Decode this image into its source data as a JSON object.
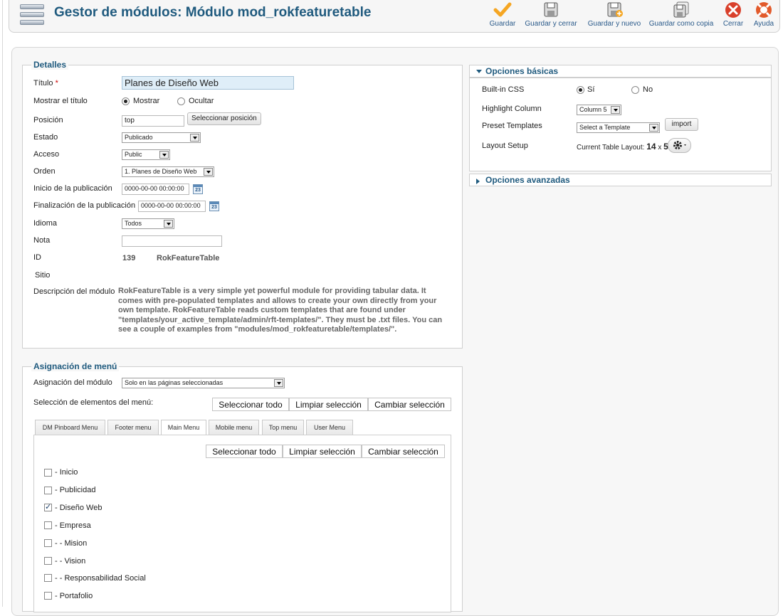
{
  "header": {
    "title": "Gestor de módulos: Módulo mod_rokfeaturetable",
    "toolbar": [
      {
        "label": "Guardar",
        "icon": "checkmark-icon"
      },
      {
        "label": "Guardar y cerrar",
        "icon": "save-icon"
      },
      {
        "label": "Guardar y nuevo",
        "icon": "save-new-icon"
      },
      {
        "label": "Guardar como copia",
        "icon": "save-copy-icon"
      },
      {
        "label": "Cerrar",
        "icon": "close-icon"
      },
      {
        "label": "Ayuda",
        "icon": "help-icon"
      }
    ]
  },
  "details": {
    "legend": "Detalles",
    "title_label": "Título",
    "title_required": "*",
    "title_value": "Planes de Diseño Web",
    "show_title_label": "Mostrar el título",
    "show_option": "Mostrar",
    "hide_option": "Ocultar",
    "position_label": "Posición",
    "position_value": "top",
    "select_position_button": "Seleccionar posición",
    "state_label": "Estado",
    "state_value": "Publicado",
    "access_label": "Acceso",
    "access_value": "Public",
    "order_label": "Orden",
    "order_value": "1. Planes de Diseño Web",
    "publish_start_label": "Inicio de la publicación",
    "publish_start_value": "0000-00-00 00:00:00",
    "publish_end_label": "Finalización de la publicación",
    "publish_end_value": "0000-00-00 00:00:00",
    "calendar_glyph": "23",
    "language_label": "Idioma",
    "language_value": "Todos",
    "note_label": "Nota",
    "note_value": "",
    "id_label": "ID",
    "id_value": "139",
    "module_name": "RokFeatureTable",
    "site_label": "Sitio",
    "description_label": "Descripción del módulo",
    "description_text": "RokFeatureTable is a very simple yet powerful module for providing tabular data. It comes with pre-populated templates and allows to create your own directly from your own template. RokFeatureTable reads custom templates that are found under \"templates/your_active_template/admin/rft-templates/\". They must be .txt files. You can see a couple of examples from \"modules/mod_rokfeaturetable/templates/\"."
  },
  "menu_assignment": {
    "legend": "Asignación de menú",
    "assignment_label": "Asignación del módulo",
    "assignment_value": "Solo en las páginas seleccionadas",
    "selection_label": "Selección de elementos del menú:",
    "select_all": "Seleccionar todo",
    "clear_selection": "Limpiar selección",
    "toggle_selection": "Cambiar selección",
    "tabs": [
      "DM Pinboard Menu",
      "Footer menu",
      "Main Menu",
      "Mobile menu",
      "Top menu",
      "User Menu"
    ],
    "active_tab": "Main Menu",
    "items": [
      {
        "label": "- Inicio",
        "checked": false
      },
      {
        "label": "- Publicidad",
        "checked": false
      },
      {
        "label": "- Diseño Web",
        "checked": true
      },
      {
        "label": "- Empresa",
        "checked": false
      },
      {
        "label": "- - Mision",
        "checked": false
      },
      {
        "label": "- - Vision",
        "checked": false
      },
      {
        "label": "- - Responsabilidad Social",
        "checked": false
      },
      {
        "label": "- Portafolio",
        "checked": false
      }
    ]
  },
  "basic_options": {
    "title": "Opciones básicas",
    "builtin_css_label": "Built-in CSS",
    "yes_option": "Sí",
    "no_option": "No",
    "highlight_label": "Highlight Column",
    "highlight_value": "Column 5",
    "preset_label": "Preset Templates",
    "preset_value": "Select a Template",
    "import_button": "import",
    "layout_label": "Layout Setup",
    "layout_text": "Current Table Layout:",
    "layout_rows": "14",
    "layout_x": "x",
    "layout_cols": "5"
  },
  "advanced_options": {
    "title": "Opciones avanzadas"
  },
  "colors": {
    "title_blue": "#1f5a7e",
    "title_input_bg": "#dfeef8",
    "save_orange": "#f5a623",
    "close_red": "#d9402b"
  }
}
